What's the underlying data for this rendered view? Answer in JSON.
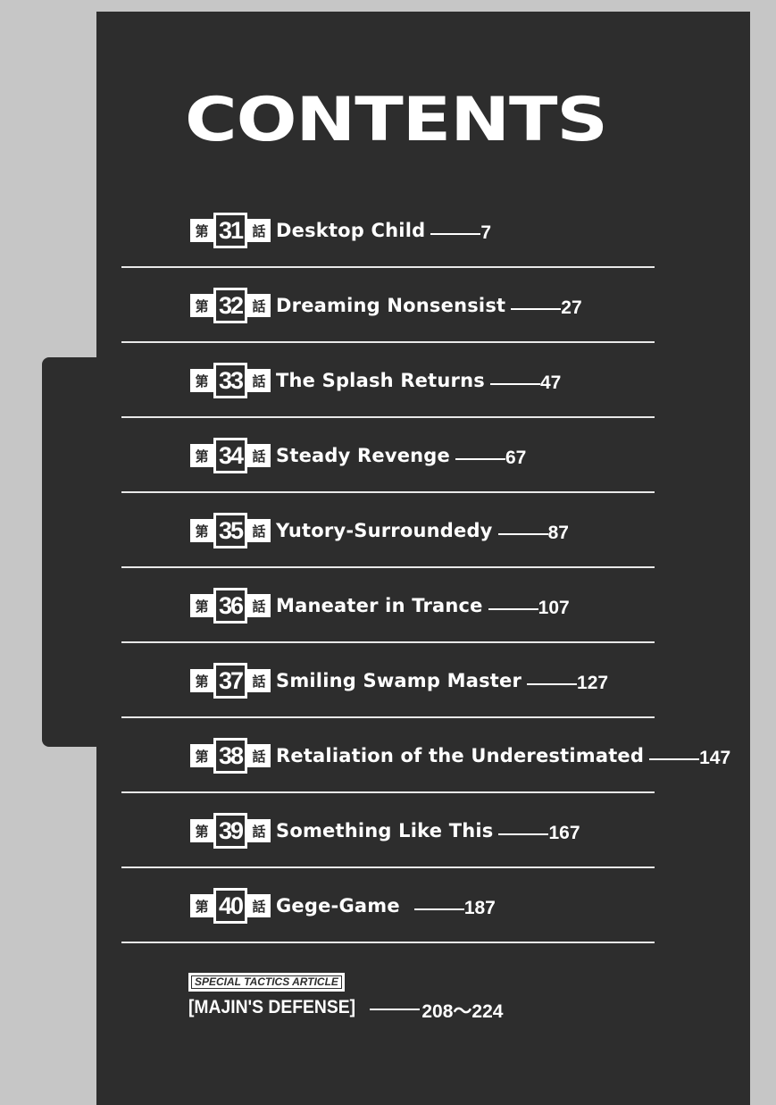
{
  "heading": "CONTENTS",
  "chapter_prefix": "第",
  "chapter_suffix": "話",
  "chapters": [
    {
      "number": "31",
      "title": "Desktop Child",
      "page": "7"
    },
    {
      "number": "32",
      "title": "Dreaming Nonsensist",
      "page": "27"
    },
    {
      "number": "33",
      "title": "The Splash Returns",
      "page": "47"
    },
    {
      "number": "34",
      "title": "Steady Revenge",
      "page": "67"
    },
    {
      "number": "35",
      "title": "Yutory-Surroundedy",
      "page": "87"
    },
    {
      "number": "36",
      "title": "Maneater in Trance",
      "page": "107"
    },
    {
      "number": "37",
      "title": "Smiling Swamp Master",
      "page": "127"
    },
    {
      "number": "38",
      "title": "Retaliation of the Underestimated",
      "page": "147"
    },
    {
      "number": "39",
      "title": "Something Like This",
      "page": "167"
    },
    {
      "number": "40",
      "title": "Gege-Game",
      "page": "187"
    }
  ],
  "special": {
    "label": "SPECIAL TACTICS ARTICLE",
    "title": "[MAJIN'S DEFENSE]",
    "pages": "208～224"
  }
}
